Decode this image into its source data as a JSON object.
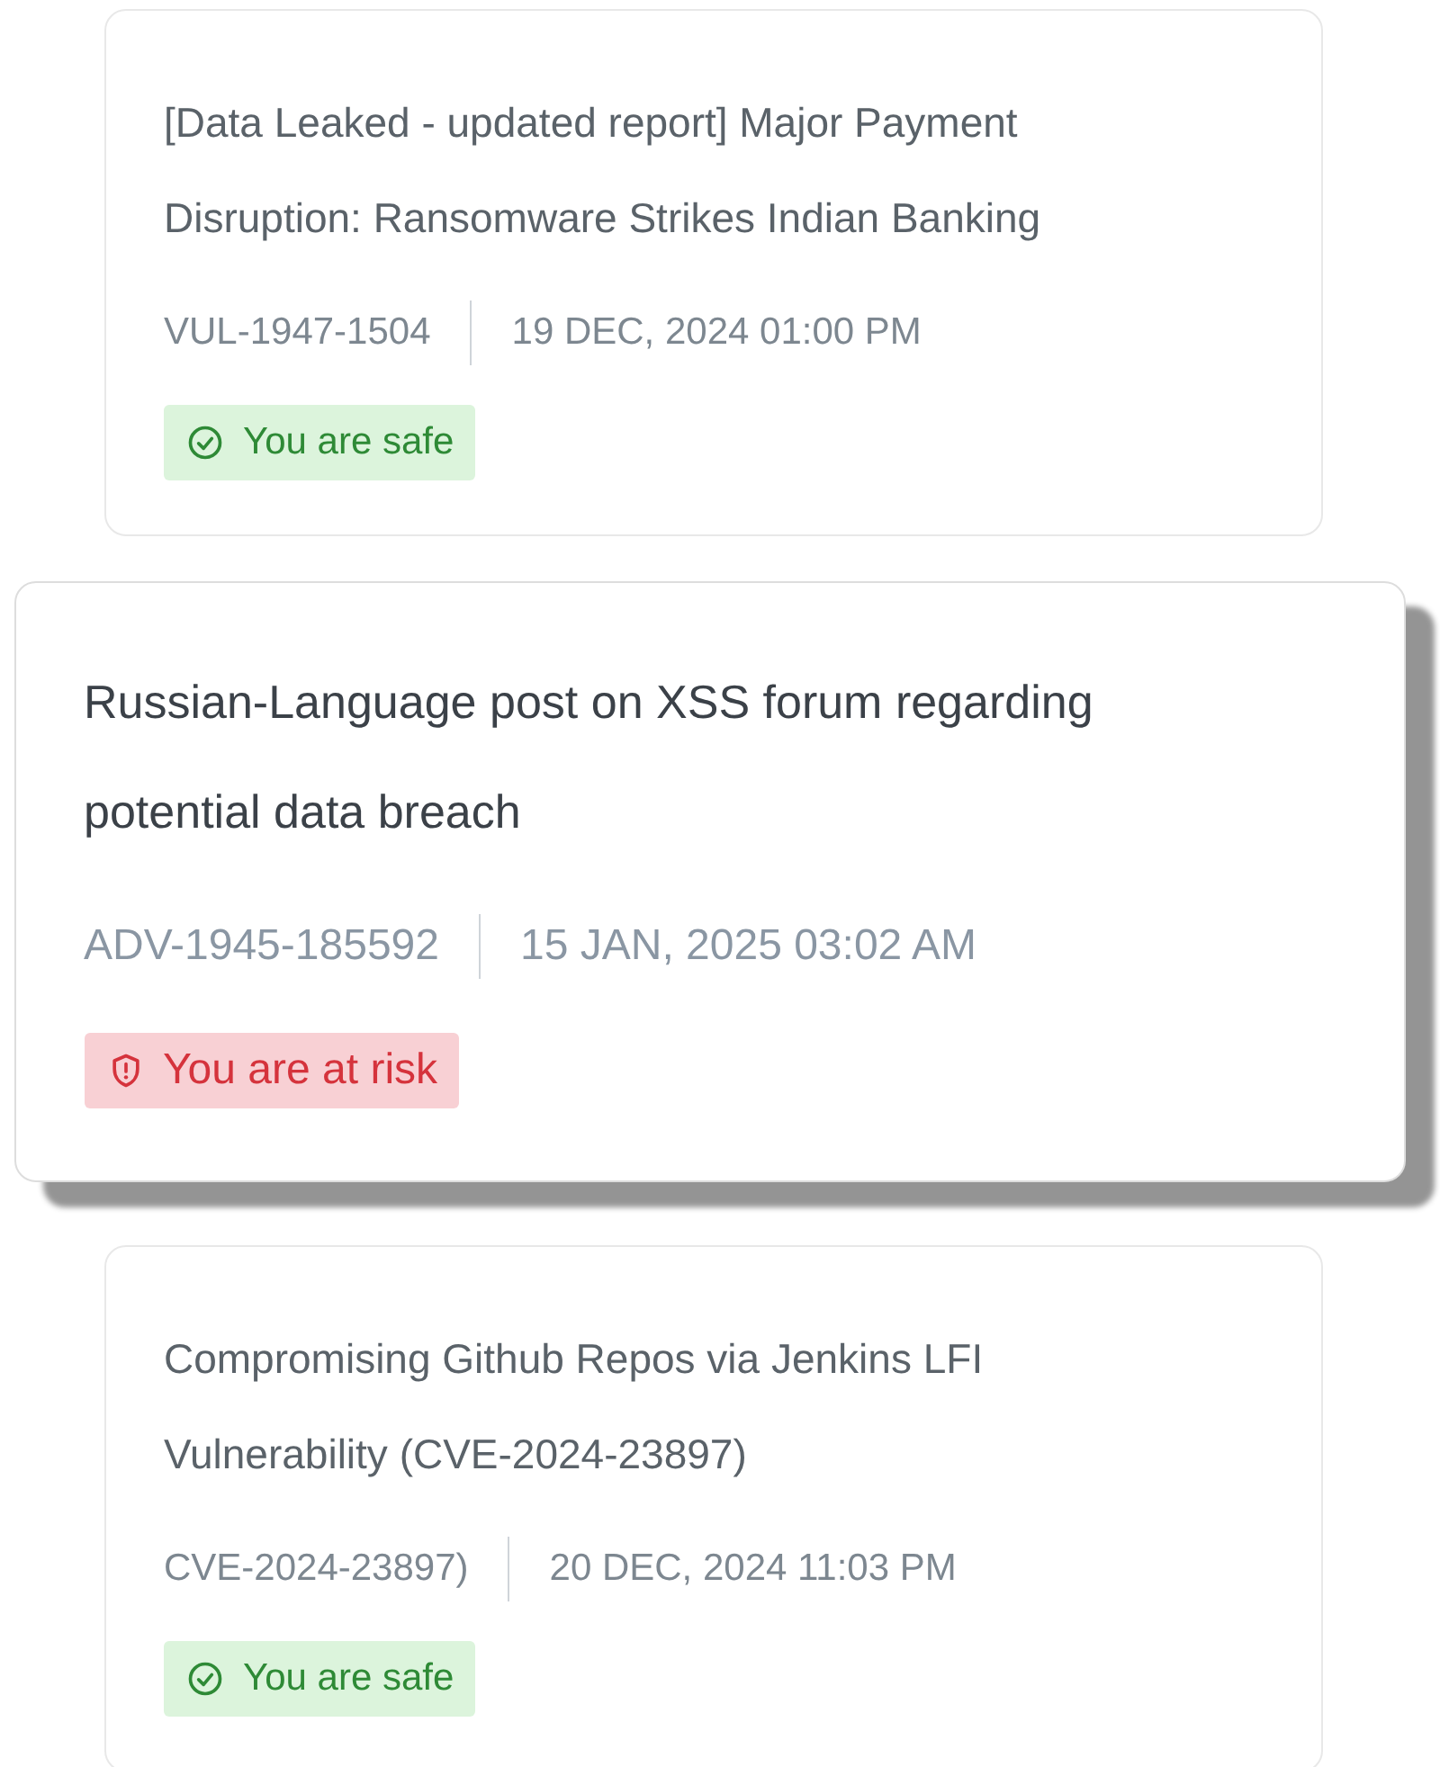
{
  "cards": [
    {
      "title": "[Data Leaked - updated report] Major Payment Disruption: Ransomware Strikes Indian Banking",
      "id": "VUL-1947-1504",
      "date": "19 DEC, 2024 01:00 PM",
      "status": {
        "kind": "safe",
        "label": "You are safe"
      },
      "dimmed": true
    },
    {
      "title": "Russian-Language post on XSS forum regarding potential data breach",
      "id": "ADV-1945-185592",
      "date": "15 JAN, 2025 03:02 AM",
      "status": {
        "kind": "risk",
        "label": "You are at risk"
      },
      "dimmed": false
    },
    {
      "title": "Compromising Github Repos via Jenkins LFI Vulnerability (CVE-2024-23897)",
      "id": "CVE-2024-23897)",
      "date": "20 DEC, 2024 11:03 PM",
      "status": {
        "kind": "safe",
        "label": "You are safe"
      },
      "dimmed": true
    }
  ]
}
